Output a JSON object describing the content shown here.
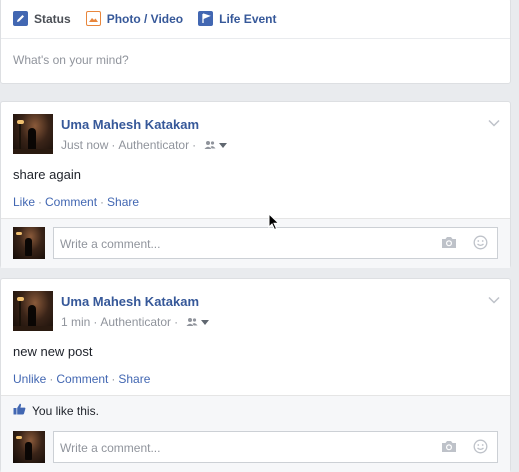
{
  "composer": {
    "tabs": [
      {
        "label": "Status",
        "icon": "pencil-icon"
      },
      {
        "label": "Photo / Video",
        "icon": "photo-icon"
      },
      {
        "label": "Life Event",
        "icon": "flag-icon"
      }
    ],
    "placeholder": "What's on your mind?"
  },
  "posts": [
    {
      "author": "Uma Mahesh Katakam",
      "time": "Just now",
      "app": "Authenticator",
      "text": "share again",
      "actions": [
        "Like",
        "Comment",
        "Share"
      ],
      "comment_placeholder": "Write a comment..."
    },
    {
      "author": "Uma Mahesh Katakam",
      "time": "1 min",
      "app": "Authenticator",
      "text": "new new post",
      "actions": [
        "Unlike",
        "Comment",
        "Share"
      ],
      "likes_text": "You like this.",
      "comment_placeholder": "Write a comment..."
    }
  ],
  "colors": {
    "link": "#4267b2",
    "author": "#365899",
    "muted": "#90949c",
    "background": "#e9ebee"
  }
}
